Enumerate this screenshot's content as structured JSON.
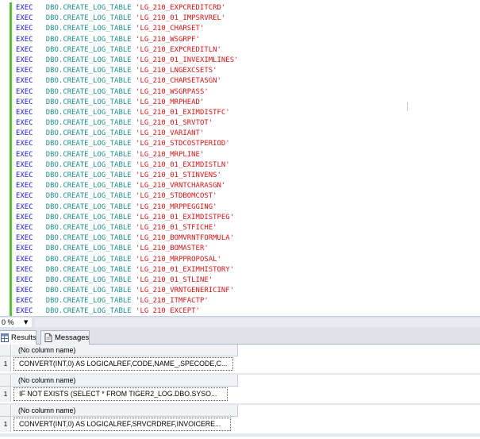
{
  "editor": {
    "keyword": "EXEC",
    "procedure": "DBO.CREATE_LOG_TABLE",
    "tables": [
      "'LG_210_EXPCREDITCRD'",
      "'LG_210_01_IMPSRVREL'",
      "'LG_210_CHARSET'",
      "'LG_210_WSGRPF'",
      "'LG_210_EXPCREDITLN'",
      "'LG_210_01_INVEXIMLINES'",
      "'LG_210_LNGEXCSETS'",
      "'LG_210_CHARSETASGN'",
      "'LG_210_WSGRPASS'",
      "'LG_210_MRPHEAD'",
      "'LG_210_01_EXIMDISTFC'",
      "'LG_210_01_SRVTOT'",
      "'LG_210_VARIANT'",
      "'LG_210_STDCOSTPERIOD'",
      "'LG_210_MRPLINE'",
      "'LG_210_01_EXIMDISTLN'",
      "'LG_210_01_STINVENS'",
      "'LG_210_VRNTCHARASGN'",
      "'LG_210_STDBOMCOST'",
      "'LG_210_MRPPEGGING'",
      "'LG_210_01_EXIMDISTPEG'",
      "'LG_210_01_STFICHE'",
      "'LG_210_BOMVRNTFORMULA'",
      "'LG_210_BOMASTER'",
      "'LG_210_MRPPROPOSAL'",
      "'LG_210_01_EXIMHISTORY'",
      "'LG_210_01_STLINE'",
      "'LG_210_VRNTGENERICINF'",
      "'LG_210_ITMFACTP'",
      "'LG 210 EXCEPT'"
    ]
  },
  "zoom": {
    "value": "0 %"
  },
  "tabs": {
    "results": "Results",
    "messages": "Messages"
  },
  "results": [
    {
      "column_header": "(No column name)",
      "row_number": "1",
      "cell": "CONVERT(INT,0) AS LOGICALREF,CODE,NAME_,SPECODE,C..."
    },
    {
      "column_header": "(No column name)",
      "row_number": "1",
      "cell": "IF NOT EXISTS (SELECT * FROM TIGER2_LOG.DBO.SYSO..."
    },
    {
      "column_header": "(No column name)",
      "row_number": "1",
      "cell": "CONVERT(INT,0) AS LOGICALREF,SRVCRDREF,INVOICERE..."
    }
  ],
  "colors": {
    "keyword": "#1515e8",
    "object": "#1f8f8f",
    "string": "#d81414",
    "change_bar": "#5bbd3b"
  }
}
